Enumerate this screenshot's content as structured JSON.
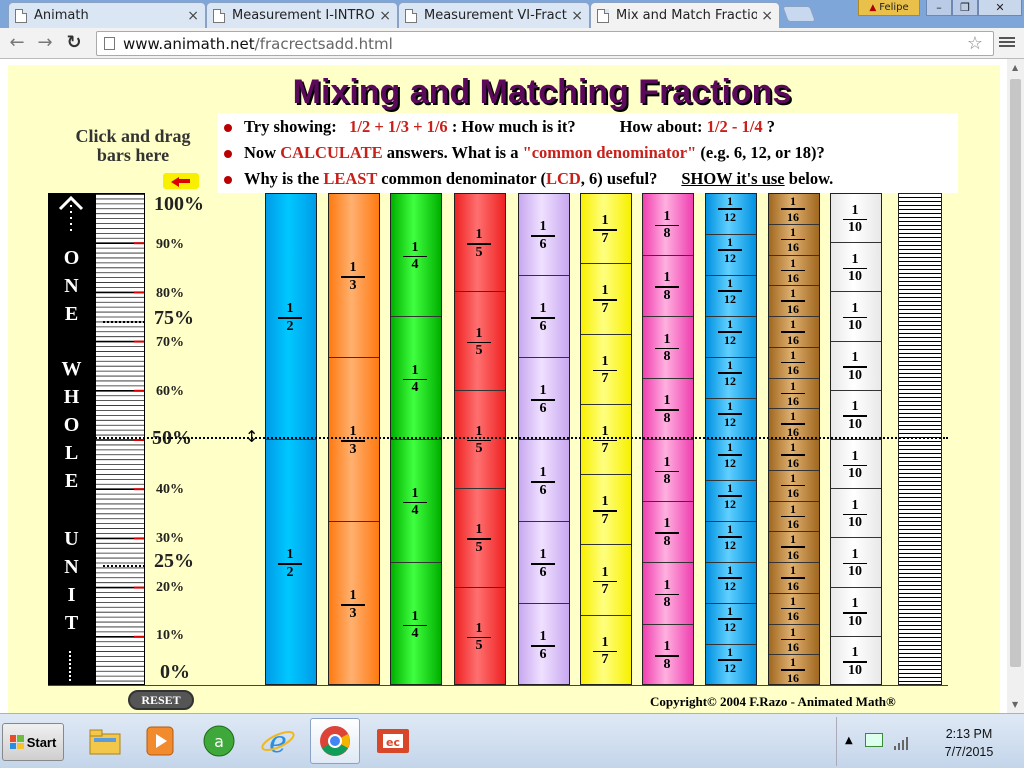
{
  "tabs": [
    {
      "label": "Animath",
      "close": "×"
    },
    {
      "label": "Measurement I-INTRO",
      "close": "×"
    },
    {
      "label": "Measurement VI-Fract",
      "close": "×"
    },
    {
      "label": "Mix and Match Fractio",
      "close": "×"
    }
  ],
  "profile": {
    "name": "Felipe"
  },
  "window_controls": {
    "minimize": "–",
    "maximize": "❐",
    "close": "✕"
  },
  "nav": {
    "back": "←",
    "forward": "→",
    "reload": "↻"
  },
  "address": {
    "host": "www.animath.net",
    "path": "/fracrectsadd.html"
  },
  "page": {
    "title": "Mixing and Matching Fractions",
    "drag_hint": "Click and drag bars here",
    "instructions": {
      "line1": {
        "a": "Try showing:",
        "b": "1/2  +  1/3  +  1/6",
        "c": " :  How much is it?",
        "d": "How about:",
        "e": "1/2 - 1/4",
        "f": " ?"
      },
      "line2": {
        "a": "Now ",
        "b": "CALCULATE",
        "c": " answers.  What is a ",
        "d": "\"common denominator\"",
        "e": " (e.g. 6, 12, or 18)?"
      },
      "line3": {
        "a": "Why is the ",
        "b": "LEAST",
        "c": " common denominator (",
        "d": "LCD",
        "e": ", 6) useful?",
        "f": "SHOW it's use",
        "g": " below."
      }
    },
    "unit_label": [
      "O",
      "N",
      "E",
      "W",
      "H",
      "O",
      "L",
      "E",
      "U",
      "N",
      "I",
      "T"
    ],
    "percent_labels": {
      "p100": "100%",
      "p90": "90%",
      "p80": "80%",
      "p75": "75%",
      "p70": "70%",
      "p60": "60%",
      "p50": "50%",
      "p40": "40%",
      "p30": "30%",
      "p25": "25%",
      "p20": "20%",
      "p10": "10%",
      "p0": "0%"
    },
    "bars": [
      {
        "denominator": 2,
        "color_top": "#00c8ff",
        "color_mid": "#009be8",
        "label_num": "1",
        "label_den": "2"
      },
      {
        "denominator": 3,
        "color_top": "#ffb070",
        "color_mid": "#ff7a10",
        "label_num": "1",
        "label_den": "3"
      },
      {
        "denominator": 4,
        "color_top": "#40ff40",
        "color_mid": "#00b000",
        "label_num": "1",
        "label_den": "4"
      },
      {
        "denominator": 5,
        "color_top": "#ff7070",
        "color_mid": "#ee2222",
        "label_num": "1",
        "label_den": "5"
      },
      {
        "denominator": 6,
        "color_top": "#f0e0ff",
        "color_mid": "#c8a8f0",
        "label_num": "1",
        "label_den": "6"
      },
      {
        "denominator": 7,
        "color_top": "#ffff80",
        "color_mid": "#f8f000",
        "label_num": "1",
        "label_den": "7"
      },
      {
        "denominator": 8,
        "color_top": "#ffb0e0",
        "color_mid": "#f040b0",
        "label_num": "1",
        "label_den": "8"
      },
      {
        "denominator": 12,
        "color_top": "#60d0ff",
        "color_mid": "#0090e0",
        "label_num": "1",
        "label_den": "12"
      },
      {
        "denominator": 16,
        "color_top": "#e0b070",
        "color_mid": "#a06820",
        "label_num": "1",
        "label_den": "16"
      },
      {
        "denominator": 10,
        "color_top": "#ffffff",
        "color_mid": "#e8e8e8",
        "label_num": "1",
        "label_den": "10"
      }
    ],
    "reset_label": "RESET",
    "copyright": "Copyright© 2004  F.Razo - Animated Math®"
  },
  "taskbar": {
    "start_label": "Start",
    "apps": [
      "folder-icon",
      "media-player-icon",
      "app-green-icon",
      "internet-explorer-icon",
      "chrome-icon",
      "powerpoint-icon"
    ],
    "clock": {
      "time": "2:13 PM",
      "date": "7/7/2015"
    }
  }
}
